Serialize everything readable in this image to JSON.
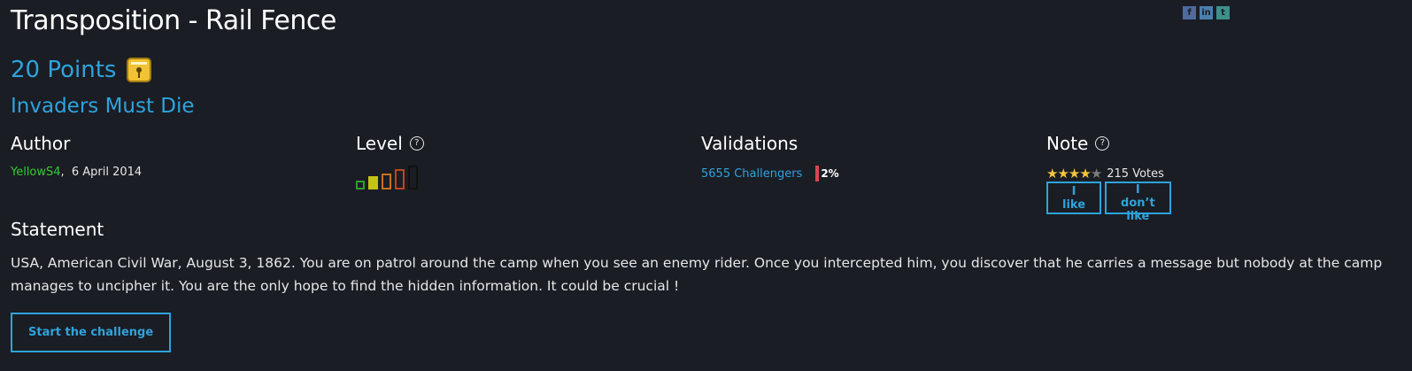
{
  "challenge": {
    "title": "Transposition - Rail Fence",
    "points": "20 Points",
    "category": "Invaders Must Die"
  },
  "share": {
    "icons": [
      "facebook-icon",
      "linkedin-icon",
      "twitter-icon"
    ],
    "labels": [
      "f",
      "in",
      "t"
    ]
  },
  "author": {
    "heading": "Author",
    "name": "YellowS4",
    "separator": ",",
    "date": "6 April 2014"
  },
  "level": {
    "heading": "Level",
    "help": "?",
    "current_level": 2,
    "max_level": 5,
    "colors": [
      "#2f9e2f",
      "#c4c414",
      "#c9711b",
      "#c24324",
      "#111111"
    ]
  },
  "validations": {
    "heading": "Validations",
    "challengers": "5655 Challengers",
    "percent": "2%"
  },
  "note": {
    "heading": "Note",
    "help": "?",
    "rating": 4,
    "max_rating": 5,
    "votes": "215 Votes",
    "like_label": "I like",
    "dislike_label": "I don’t like"
  },
  "statement": {
    "heading": "Statement",
    "text": "USA, American Civil War, August 3, 1862. You are on patrol around the camp when you see an enemy rider. Once you intercepted him, you discover that he carries a message but nobody at the camp manages to uncipher it. You are the only hope to find the hidden information. It could be crucial !"
  },
  "start_button": "Start the challenge",
  "colors": {
    "accent": "#2ea3dd",
    "background": "#1a1d24",
    "author": "#33cc33",
    "percent_bar": "#d94451",
    "star": "#f0c53b"
  }
}
